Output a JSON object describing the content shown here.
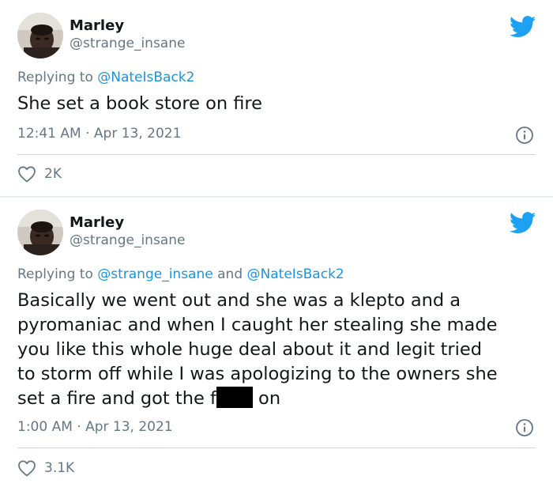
{
  "tweets": [
    {
      "author_name": "Marley",
      "author_handle": "@strange_insane",
      "replying_prefix": "Replying to ",
      "replying_mentions": [
        "@NateIsBack2"
      ],
      "replying_joiner": "",
      "text": "She set a book store on fire",
      "time": "12:41 AM",
      "date_separator": " · ",
      "date": "Apr 13, 2021",
      "likes": "2K",
      "icons": {
        "bird": "twitter-bird-icon",
        "info": "info-icon",
        "heart": "heart-icon"
      }
    },
    {
      "author_name": "Marley",
      "author_handle": "@strange_insane",
      "replying_prefix": "Replying to ",
      "replying_mentions": [
        "@strange_insane",
        "@NateIsBack2"
      ],
      "replying_joiner": " and ",
      "text_lines": [
        "Basically we went out and she was a klepto and a",
        "pyromaniac and when I caught her stealing she made",
        "you like this whole huge deal about it and legit tried",
        "to storm off while I was apologizing to the owners she"
      ],
      "text_last_before": "set a fire and got the f",
      "text_last_after": " on",
      "time": "1:00 AM",
      "date_separator": " · ",
      "date": "Apr 13, 2021",
      "likes": "3.1K"
    }
  ],
  "colors": {
    "text": "#14171a",
    "secondary": "#657786",
    "link": "#1b95e0",
    "brand": "#1da1f2",
    "divider": "#ccd6dd"
  }
}
